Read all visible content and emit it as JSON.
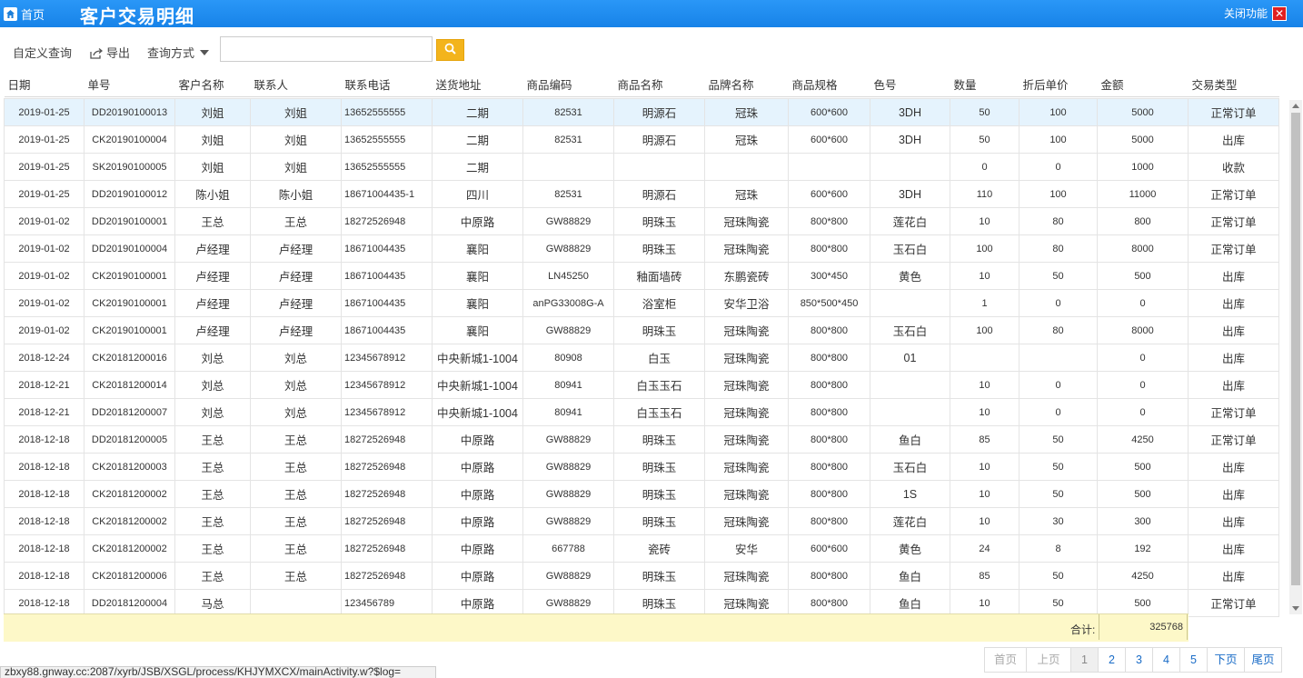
{
  "header": {
    "home_label": "首页",
    "title": "客户交易明细",
    "close_label": "关闭功能",
    "close_glyph": "✕",
    "bg_color": "#1e8cf0"
  },
  "toolbar": {
    "custom_query": "自定义查询",
    "export": "导出",
    "query_mode": "查询方式",
    "search_value": "",
    "search_placeholder": ""
  },
  "table": {
    "columns": [
      "日期",
      "单号",
      "客户名称",
      "联系人",
      "联系电话",
      "送货地址",
      "商品编码",
      "商品名称",
      "品牌名称",
      "商品规格",
      "色号",
      "数量",
      "折后单价",
      "金额",
      "交易类型"
    ],
    "rows": [
      [
        "2019-01-25",
        "DD20190100013",
        "刘姐",
        "刘姐",
        "13652555555",
        "二期",
        "82531",
        "明源石",
        "冠珠",
        "600*600",
        "3DH",
        "50",
        "100",
        "5000",
        "正常订单"
      ],
      [
        "2019-01-25",
        "CK20190100004",
        "刘姐",
        "刘姐",
        "13652555555",
        "二期",
        "82531",
        "明源石",
        "冠珠",
        "600*600",
        "3DH",
        "50",
        "100",
        "5000",
        "出库"
      ],
      [
        "2019-01-25",
        "SK20190100005",
        "刘姐",
        "刘姐",
        "13652555555",
        "二期",
        "",
        "",
        "",
        "",
        "",
        "0",
        "0",
        "1000",
        "收款"
      ],
      [
        "2019-01-25",
        "DD20190100012",
        "陈小姐",
        "陈小姐",
        "18671004435-1",
        "四川",
        "82531",
        "明源石",
        "冠珠",
        "600*600",
        "3DH",
        "110",
        "100",
        "11000",
        "正常订单"
      ],
      [
        "2019-01-02",
        "DD20190100001",
        "王总",
        "王总",
        "18272526948",
        "中原路",
        "GW88829",
        "明珠玉",
        "冠珠陶瓷",
        "800*800",
        "莲花白",
        "10",
        "80",
        "800",
        "正常订单"
      ],
      [
        "2019-01-02",
        "DD20190100004",
        "卢经理",
        "卢经理",
        "18671004435",
        "襄阳",
        "GW88829",
        "明珠玉",
        "冠珠陶瓷",
        "800*800",
        "玉石白",
        "100",
        "80",
        "8000",
        "正常订单"
      ],
      [
        "2019-01-02",
        "CK20190100001",
        "卢经理",
        "卢经理",
        "18671004435",
        "襄阳",
        "LN45250",
        "釉面墙砖",
        "东鹏瓷砖",
        "300*450",
        "黄色",
        "10",
        "50",
        "500",
        "出库"
      ],
      [
        "2019-01-02",
        "CK20190100001",
        "卢经理",
        "卢经理",
        "18671004435",
        "襄阳",
        "anPG33008G-A",
        "浴室柜",
        "安华卫浴",
        "850*500*450",
        "",
        "1",
        "0",
        "0",
        "出库"
      ],
      [
        "2019-01-02",
        "CK20190100001",
        "卢经理",
        "卢经理",
        "18671004435",
        "襄阳",
        "GW88829",
        "明珠玉",
        "冠珠陶瓷",
        "800*800",
        "玉石白",
        "100",
        "80",
        "8000",
        "出库"
      ],
      [
        "2018-12-24",
        "CK20181200016",
        "刘总",
        "刘总",
        "12345678912",
        "中央新城1-1004",
        "80908",
        "白玉",
        "冠珠陶瓷",
        "800*800",
        "01",
        "",
        "",
        "0",
        "出库"
      ],
      [
        "2018-12-21",
        "CK20181200014",
        "刘总",
        "刘总",
        "12345678912",
        "中央新城1-1004",
        "80941",
        "白玉玉石",
        "冠珠陶瓷",
        "800*800",
        "",
        "10",
        "0",
        "0",
        "出库"
      ],
      [
        "2018-12-21",
        "DD20181200007",
        "刘总",
        "刘总",
        "12345678912",
        "中央新城1-1004",
        "80941",
        "白玉玉石",
        "冠珠陶瓷",
        "800*800",
        "",
        "10",
        "0",
        "0",
        "正常订单"
      ],
      [
        "2018-12-18",
        "DD20181200005",
        "王总",
        "王总",
        "18272526948",
        "中原路",
        "GW88829",
        "明珠玉",
        "冠珠陶瓷",
        "800*800",
        "鱼白",
        "85",
        "50",
        "4250",
        "正常订单"
      ],
      [
        "2018-12-18",
        "CK20181200003",
        "王总",
        "王总",
        "18272526948",
        "中原路",
        "GW88829",
        "明珠玉",
        "冠珠陶瓷",
        "800*800",
        "玉石白",
        "10",
        "50",
        "500",
        "出库"
      ],
      [
        "2018-12-18",
        "CK20181200002",
        "王总",
        "王总",
        "18272526948",
        "中原路",
        "GW88829",
        "明珠玉",
        "冠珠陶瓷",
        "800*800",
        "1S",
        "10",
        "50",
        "500",
        "出库"
      ],
      [
        "2018-12-18",
        "CK20181200002",
        "王总",
        "王总",
        "18272526948",
        "中原路",
        "GW88829",
        "明珠玉",
        "冠珠陶瓷",
        "800*800",
        "莲花白",
        "10",
        "30",
        "300",
        "出库"
      ],
      [
        "2018-12-18",
        "CK20181200002",
        "王总",
        "王总",
        "18272526948",
        "中原路",
        "667788",
        "瓷砖",
        "安华",
        "600*600",
        "黄色",
        "24",
        "8",
        "192",
        "出库"
      ],
      [
        "2018-12-18",
        "CK20181200006",
        "王总",
        "王总",
        "18272526948",
        "中原路",
        "GW88829",
        "明珠玉",
        "冠珠陶瓷",
        "800*800",
        "鱼白",
        "85",
        "50",
        "4250",
        "出库"
      ],
      [
        "2018-12-18",
        "DD20181200004",
        "马总",
        "",
        "123456789",
        "中原路",
        "GW88829",
        "明珠玉",
        "冠珠陶瓷",
        "800*800",
        "鱼白",
        "10",
        "50",
        "500",
        "正常订单"
      ]
    ],
    "selected_row": 0,
    "selected_color": "#e5f3fd"
  },
  "summary": {
    "label": "合计:",
    "total": "325768",
    "bg_color": "#fdf8c8"
  },
  "pager": {
    "first": "首页",
    "prev": "上页",
    "pages": [
      "1",
      "2",
      "3",
      "4",
      "5"
    ],
    "current": "1",
    "next": "下页",
    "last": "尾页"
  },
  "status_url": "zbxy88.gnway.cc:2087/xyrb/JSB/XSGL/process/KHJYMXCX/mainActivity.w?$log="
}
